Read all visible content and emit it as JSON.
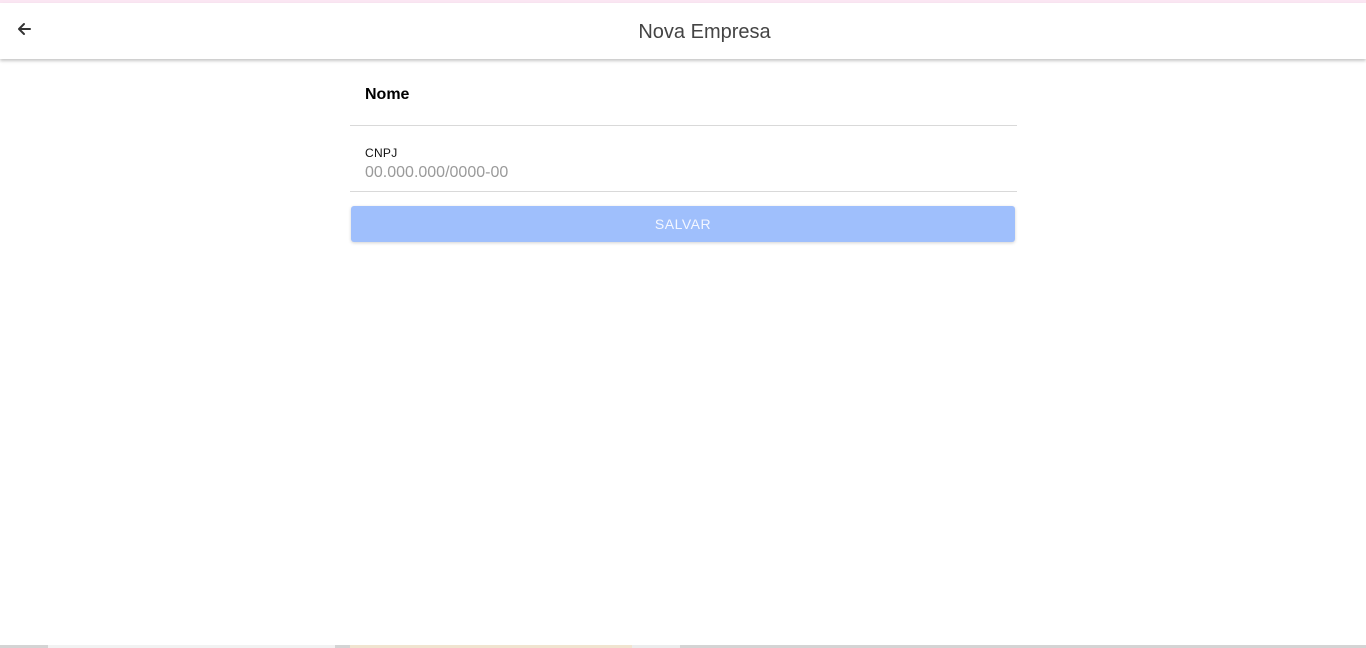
{
  "header": {
    "title": "Nova Empresa",
    "back_icon": "arrow-left-icon"
  },
  "form": {
    "nome": {
      "label": "Nome",
      "value": ""
    },
    "cnpj": {
      "label": "CNPJ",
      "value": "",
      "placeholder": "00.000.000/0000-00"
    },
    "save_label": "SALVAR"
  },
  "colors": {
    "accent_disabled": "#9fbffc",
    "title_text": "#444444"
  }
}
